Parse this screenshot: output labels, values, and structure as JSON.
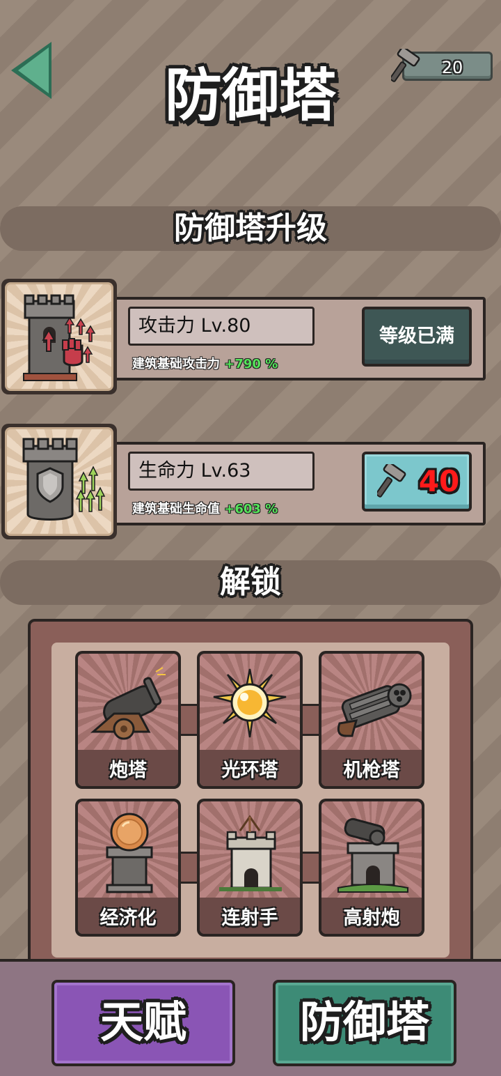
{
  "header": {
    "title": "防御塔",
    "back_icon": "back-arrow-icon",
    "resource": {
      "icon": "hammer-icon",
      "count": "20"
    }
  },
  "upgrade_section": {
    "title": "防御塔升级",
    "items": [
      {
        "name": "攻击力 Lv.80",
        "desc": "建筑基础攻击力",
        "bonus": "+790 %",
        "icon": "attack-tower-icon",
        "action": {
          "type": "maxed",
          "label": "等级已满"
        }
      },
      {
        "name": "生命力 Lv.63",
        "desc": "建筑基础生命值",
        "bonus": "+603 %",
        "icon": "health-tower-icon",
        "action": {
          "type": "cost",
          "icon": "hammer-icon",
          "cost": "40"
        }
      }
    ]
  },
  "unlock_section": {
    "title": "解锁",
    "towers": [
      {
        "label": "炮塔",
        "icon": "cannon-icon"
      },
      {
        "label": "光环塔",
        "icon": "aura-orb-icon"
      },
      {
        "label": "机枪塔",
        "icon": "gatling-gun-icon"
      },
      {
        "label": "经济化",
        "icon": "coin-tower-icon"
      },
      {
        "label": "连射手",
        "icon": "archer-tower-icon"
      },
      {
        "label": "高射炮",
        "icon": "antiair-tower-icon"
      }
    ]
  },
  "bottom_nav": {
    "talent_label": "天赋",
    "tower_label": "防御塔"
  },
  "colors": {
    "background": "#9a8a7c",
    "banner": "#7c6c61",
    "max_button": "#3e5755",
    "cost_button": "#7cc7cc",
    "bonus_text": "#56e35b",
    "cost_text": "#ff1a1a",
    "talent_button": "#8a55b5",
    "tower_button": "#3d8b76"
  }
}
